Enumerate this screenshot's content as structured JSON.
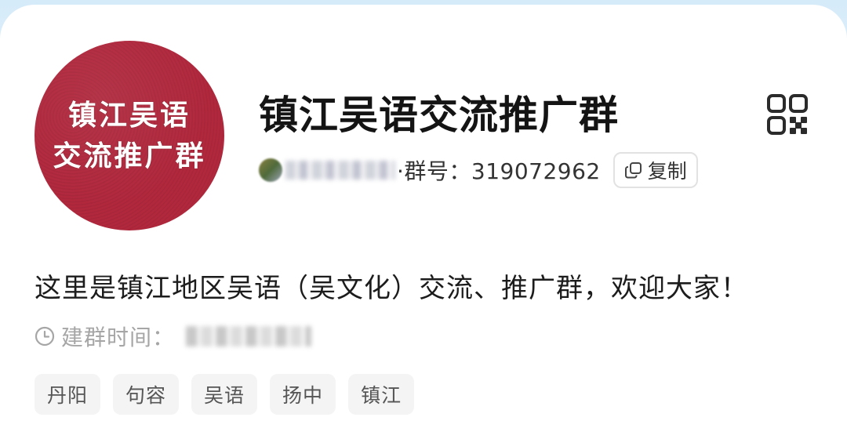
{
  "group": {
    "avatar_text_line1": "镇江吴语",
    "avatar_text_line2": "交流推广群",
    "title": "镇江吴语交流推广群",
    "meta_suffix": "·群号：319072962",
    "copy_label": "复制",
    "description": "这里是镇江地区吴语（吴文化）交流、推广群，欢迎大家！",
    "created_label": "建群时间：",
    "tags": [
      "丹阳",
      "句容",
      "吴语",
      "扬中",
      "镇江"
    ]
  },
  "icons": {
    "qr": "qr-code-icon",
    "copy": "copy-icon",
    "clock": "clock-icon"
  },
  "colors": {
    "avatar_bg": "#b1283d",
    "title": "#141414",
    "muted": "#a6a6a6",
    "tag_bg": "#f4f4f4"
  }
}
